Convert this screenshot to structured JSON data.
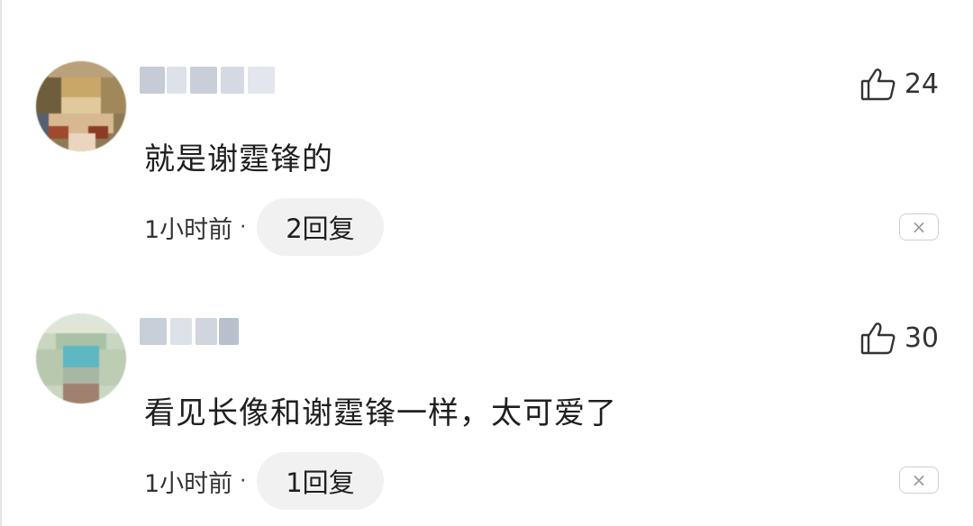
{
  "comments": [
    {
      "content": "就是谢霆锋的",
      "likes": "24",
      "time": "1小时前",
      "separator": "·",
      "replies": "2回复"
    },
    {
      "content": "看见长像和谢霆锋一样，太可爱了",
      "likes": "30",
      "time": "1小时前",
      "separator": "·",
      "replies": "1回复"
    }
  ],
  "icons": {
    "like": "thumbs-up-icon",
    "dismiss": "close-icon",
    "close_glyph": "×"
  },
  "colors": {
    "text": "#1f1f1f",
    "meta_text": "#333333",
    "pill_bg": "#f1f1f1",
    "border": "#cfcfcf"
  }
}
